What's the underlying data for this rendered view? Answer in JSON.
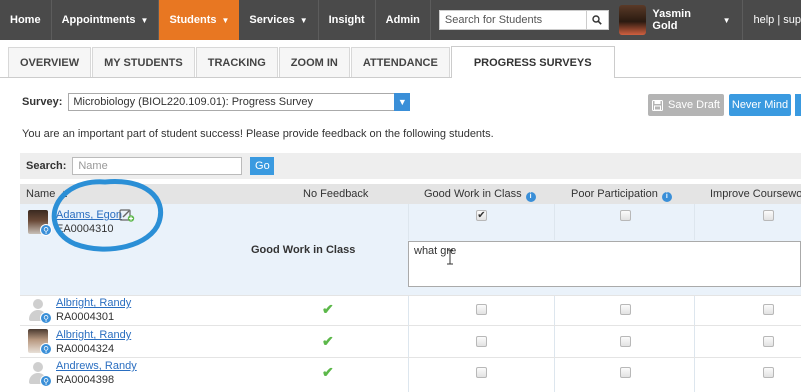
{
  "nav": {
    "home": "Home",
    "appointments": "Appointments",
    "students": "Students",
    "services": "Services",
    "insight": "Insight",
    "admin": "Admin",
    "search_placeholder": "Search for Students",
    "user_name": "Yasmin Gold",
    "help": "help | sup",
    "active_color": "#e87722"
  },
  "tabs": [
    "OVERVIEW",
    "MY STUDENTS",
    "TRACKING",
    "ZOOM IN",
    "ATTENDANCE",
    "PROGRESS SURVEYS"
  ],
  "survey": {
    "label": "Survey:",
    "selected": "Microbiology (BIOL220.109.01): Progress Survey"
  },
  "buttons": {
    "save_draft": "Save Draft",
    "never_mind": "Never Mind"
  },
  "intro": "You are an important part of student success! Please provide feedback on the following students.",
  "search": {
    "label": "Search:",
    "placeholder": "Name",
    "go": "Go"
  },
  "table": {
    "headers": {
      "name": "Name ▲",
      "no_feedback": "No Feedback",
      "good_work": "Good Work in Class",
      "poor_participation": "Poor Participation",
      "improve_coursework": "Improve Coursewor"
    },
    "rows": [
      {
        "name": "Adams, Egon",
        "id": "EA0004310",
        "avatar": "photo-dark",
        "no_feedback": false,
        "good_work": true,
        "poor_participation": false,
        "improve": false
      },
      {
        "name": "Albright, Randy",
        "id": "RA0004301",
        "avatar": "placeholder",
        "no_feedback": true,
        "good_work": false,
        "poor_participation": false,
        "improve": false
      },
      {
        "name": "Albright, Randy",
        "id": "RA0004324",
        "avatar": "photo-light",
        "no_feedback": true,
        "good_work": false,
        "poor_participation": false,
        "improve": false
      },
      {
        "name": "Andrews, Randy",
        "id": "RA0004398",
        "avatar": "placeholder",
        "no_feedback": true,
        "good_work": false,
        "poor_participation": false,
        "improve": false
      }
    ],
    "feedback": {
      "label": "Good Work in Class",
      "text": "what gre"
    }
  },
  "icons": {
    "search": "magnifier-icon",
    "save": "floppy-disk-icon",
    "edit": "edit-note-icon",
    "check": "checkmark-icon",
    "info": "info-icon"
  }
}
